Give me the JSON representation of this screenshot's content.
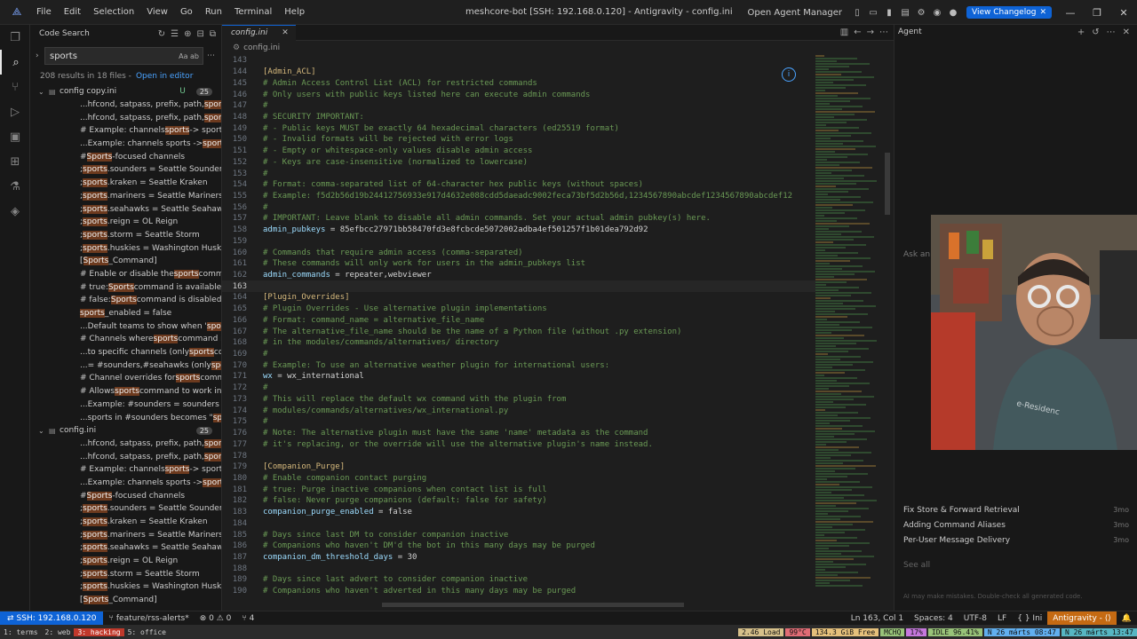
{
  "titlebar": {
    "menu": [
      "File",
      "Edit",
      "Selection",
      "View",
      "Go",
      "Run",
      "Terminal",
      "Help"
    ],
    "window_title": "meshcore-bot [SSH: 192.168.0.120] - Antigravity - config.ini",
    "agent_manager": "Open Agent Manager",
    "changelog_label": "View Changelog"
  },
  "sidebar": {
    "title": "Code Search",
    "search_value": "sports",
    "search_options": "Aa ab",
    "results_summary": "208 results in 18 files -",
    "open_in_editor": "Open in editor",
    "files": [
      {
        "name": "config copy.ini",
        "status": "U",
        "count": "25",
        "matches": [
          [
            "...hfcond, satpass, prefix, path, ",
            "sports",
            ", dice, r..."
          ],
          [
            "...hfcond, satpass, prefix, path, ",
            "sports",
            ", dice, r..."
          ],
          [
            "# Example: channels ",
            "sports",
            " -> sports.sounder..."
          ],
          [
            "...Example: channels sports -> ",
            "sports",
            ".sounder..."
          ],
          [
            "# ",
            "Sports",
            "-focused channels"
          ],
          [
            "; ",
            "sports",
            ".sounders = Seattle Sounders FC"
          ],
          [
            "; ",
            "sports",
            ".kraken = Seattle Kraken"
          ],
          [
            "; ",
            "sports",
            ".mariners = Seattle Mariners"
          ],
          [
            "; ",
            "sports",
            ".seahawks = Seattle Seahawks"
          ],
          [
            "; ",
            "sports",
            ".reign = OL Reign"
          ],
          [
            "; ",
            "sports",
            ".storm = Seattle Storm"
          ],
          [
            "; ",
            "sports",
            ".huskies = Washington Huskies"
          ],
          [
            "[",
            "Sports",
            "_Command]"
          ],
          [
            "# Enable or disable the ",
            "sports",
            " command"
          ],
          [
            "# true: ",
            "Sports",
            " command is available"
          ],
          [
            "# false: ",
            "Sports",
            " command is disabled"
          ],
          [
            "",
            "sports",
            "_enabled = false"
          ],
          [
            "...Default teams to show when '",
            "sports",
            "' comm..."
          ],
          [
            "# Channels where ",
            "sports",
            " command is allowed"
          ],
          [
            "...to specific channels (only ",
            "sports",
            " command ..."
          ],
          [
            "...= #sounders,#seahawks (only ",
            "sports",
            " comm..."
          ],
          [
            "# Channel overrides for ",
            "sports",
            " command"
          ],
          [
            "# Allows ",
            "sports",
            " command to work in specific ..."
          ],
          [
            "...Example: #sounders = sounders (",
            "sports",
            " in #..."
          ],
          [
            "...sports in #sounders becomes \"",
            "sports",
            " soun..."
          ]
        ]
      },
      {
        "name": "config.ini",
        "status": "",
        "count": "25",
        "matches": [
          [
            "...hfcond, satpass, prefix, path, ",
            "sports",
            ", dice, r..."
          ],
          [
            "...hfcond, satpass, prefix, path, ",
            "sports",
            ", dice, r..."
          ],
          [
            "# Example: channels ",
            "sports",
            " -> sports.sounder..."
          ],
          [
            "...Example: channels sports -> ",
            "sports",
            ".sounder..."
          ],
          [
            "# ",
            "Sports",
            "-focused channels"
          ],
          [
            "; ",
            "sports",
            ".sounders = Seattle Sounders FC"
          ],
          [
            "; ",
            "sports",
            ".kraken = Seattle Kraken"
          ],
          [
            "; ",
            "sports",
            ".mariners = Seattle Mariners"
          ],
          [
            "; ",
            "sports",
            ".seahawks = Seattle Seahawks"
          ],
          [
            "; ",
            "sports",
            ".reign = OL Reign"
          ],
          [
            "; ",
            "sports",
            ".storm = Seattle Storm"
          ],
          [
            "; ",
            "sports",
            ".huskies = Washington Huskies"
          ],
          [
            "[",
            "Sports",
            "_Command]"
          ]
        ]
      }
    ]
  },
  "editor": {
    "tab_label": "config.ini",
    "breadcrumb": "config.ini",
    "current_line": 163,
    "lines": [
      {
        "n": 143,
        "t": "",
        "k": "plain"
      },
      {
        "n": 144,
        "t": "[Admin_ACL]",
        "k": "section"
      },
      {
        "n": 145,
        "t": "# Admin Access Control List (ACL) for restricted commands",
        "k": "comment"
      },
      {
        "n": 146,
        "t": "# Only users with public keys listed here can execute admin commands",
        "k": "comment"
      },
      {
        "n": 147,
        "t": "#",
        "k": "comment"
      },
      {
        "n": 148,
        "t": "# SECURITY IMPORTANT:",
        "k": "comment"
      },
      {
        "n": 149,
        "t": "# - Public keys MUST be exactly 64 hexadecimal characters (ed25519 format)",
        "k": "comment"
      },
      {
        "n": 150,
        "t": "# - Invalid formats will be rejected with error logs",
        "k": "comment"
      },
      {
        "n": 151,
        "t": "# - Empty or whitespace-only values disable admin access",
        "k": "comment"
      },
      {
        "n": 152,
        "t": "# - Keys are case-insensitive (normalized to lowercase)",
        "k": "comment"
      },
      {
        "n": 153,
        "t": "#",
        "k": "comment"
      },
      {
        "n": 154,
        "t": "# Format: comma-separated list of 64-character hex public keys (without spaces)",
        "k": "comment"
      },
      {
        "n": 155,
        "t": "# Example: f5d2b56d19b24412756933e917d4632e088cdd5daeadc9002feca73bf5d2b56d,1234567890abcdef1234567890abcdef12",
        "k": "comment"
      },
      {
        "n": 156,
        "t": "#",
        "k": "comment"
      },
      {
        "n": 157,
        "t": "# IMPORTANT: Leave blank to disable all admin commands. Set your actual admin pubkey(s) here.",
        "k": "comment"
      },
      {
        "n": 158,
        "key": "admin_pubkeys",
        "t": " = 85efbcc27971bb58470fd3e8fcbcde5072002adba4ef501257f1b01dea792d92",
        "k": "kv"
      },
      {
        "n": 159,
        "t": "",
        "k": "plain"
      },
      {
        "n": 160,
        "t": "# Commands that require admin access (comma-separated)",
        "k": "comment"
      },
      {
        "n": 161,
        "t": "# These commands will only work for users in the admin_pubkeys list",
        "k": "comment"
      },
      {
        "n": 162,
        "key": "admin_commands",
        "t": " = repeater,webviewer",
        "k": "kv"
      },
      {
        "n": 163,
        "t": "",
        "k": "plain"
      },
      {
        "n": 164,
        "t": "[Plugin_Overrides]",
        "k": "section"
      },
      {
        "n": 165,
        "t": "# Plugin Overrides - Use alternative plugin implementations",
        "k": "comment"
      },
      {
        "n": 166,
        "t": "# Format: command_name = alternative_file_name",
        "k": "comment"
      },
      {
        "n": 167,
        "t": "# The alternative_file_name should be the name of a Python file (without .py extension)",
        "k": "comment"
      },
      {
        "n": 168,
        "t": "# in the modules/commands/alternatives/ directory",
        "k": "comment"
      },
      {
        "n": 169,
        "t": "#",
        "k": "comment"
      },
      {
        "n": 170,
        "t": "# Example: To use an alternative weather plugin for international users:",
        "k": "comment"
      },
      {
        "n": 171,
        "key": "wx",
        "t": " = wx_international",
        "k": "kv"
      },
      {
        "n": 172,
        "t": "#",
        "k": "comment"
      },
      {
        "n": 173,
        "t": "# This will replace the default wx command with the plugin from",
        "k": "comment"
      },
      {
        "n": 174,
        "t": "# modules/commands/alternatives/wx_international.py",
        "k": "comment"
      },
      {
        "n": 175,
        "t": "#",
        "k": "comment"
      },
      {
        "n": 176,
        "t": "# Note: The alternative plugin must have the same 'name' metadata as the command",
        "k": "comment"
      },
      {
        "n": 177,
        "t": "# it's replacing, or the override will use the alternative plugin's name instead.",
        "k": "comment"
      },
      {
        "n": 178,
        "t": "",
        "k": "plain"
      },
      {
        "n": 179,
        "t": "[Companion_Purge]",
        "k": "section"
      },
      {
        "n": 180,
        "t": "# Enable companion contact purging",
        "k": "comment"
      },
      {
        "n": 181,
        "t": "# true: Purge inactive companions when contact list is full",
        "k": "comment"
      },
      {
        "n": 182,
        "t": "# false: Never purge companions (default: false for safety)",
        "k": "comment"
      },
      {
        "n": 183,
        "key": "companion_purge_enabled",
        "t": " = false",
        "k": "kv"
      },
      {
        "n": 184,
        "t": "",
        "k": "plain"
      },
      {
        "n": 185,
        "t": "# Days since last DM to consider companion inactive",
        "k": "comment"
      },
      {
        "n": 186,
        "t": "# Companions who haven't DM'd the bot in this many days may be purged",
        "k": "comment"
      },
      {
        "n": 187,
        "key": "companion_dm_threshold_days",
        "t": " = 30",
        "k": "kv"
      },
      {
        "n": 188,
        "t": "",
        "k": "plain"
      },
      {
        "n": 189,
        "t": "# Days since last advert to consider companion inactive",
        "k": "comment"
      },
      {
        "n": 190,
        "t": "# Companions who haven't adverted in this many days may be purged",
        "k": "comment"
      },
      {
        "n": 191,
        "key": "companion_advert_threshold_days",
        "t": " = 30",
        "k": "kv"
      },
      {
        "n": 192,
        "t": "",
        "k": "plain"
      }
    ]
  },
  "agent": {
    "title": "Agent",
    "input_ghost": "Ask an",
    "conversations": [
      {
        "title": "Fix Store & Forward Retrieval",
        "ago": "3mo"
      },
      {
        "title": "Adding Command Aliases",
        "ago": "3mo"
      },
      {
        "title": "Per-User Message Delivery",
        "ago": "3mo"
      }
    ],
    "see_all": "See all",
    "disclaimer": "AI may make mistakes. Double-check all generated code."
  },
  "statusbar": {
    "remote": "SSH: 192.168.0.120",
    "branch": "feature/rss-alerts*",
    "problems": "⊗ 0 ⚠ 0",
    "ports": "⑂ 4",
    "position": "Ln 163, Col 1",
    "spaces": "Spaces: 4",
    "encoding": "UTF-8",
    "eol": "LF",
    "language": "{ } Ini",
    "agent_pill": "Antigravity - ⟨⟩"
  },
  "tmux": {
    "windows": [
      {
        "label": "1: terms",
        "active": false
      },
      {
        "label": "2: web",
        "active": false
      },
      {
        "label": "3: hacking",
        "active": true
      },
      {
        "label": "5: office",
        "active": false
      }
    ],
    "stats": [
      {
        "label": "2.46 Load",
        "color": "#d6c08a"
      },
      {
        "label": "99°C",
        "color": "#e06c75"
      },
      {
        "label": "134.3 GiB Free",
        "color": "#e5c07b"
      },
      {
        "label": "MCHQ",
        "color": "#98c379"
      },
      {
        "label": "17%",
        "color": "#c678dd"
      },
      {
        "label": "IDLE 96.41%",
        "color": "#98c379"
      },
      {
        "label": "N 26 márts 08:47",
        "color": "#61afef"
      },
      {
        "label": "N 26 márts 13:47",
        "color": "#56b6c2"
      }
    ]
  },
  "colors": {
    "accent": "#0e63d6",
    "match_highlight": "#6d3a1e",
    "comment": "#6a9955",
    "section": "#d7ba7d",
    "key": "#9cdcfe"
  }
}
